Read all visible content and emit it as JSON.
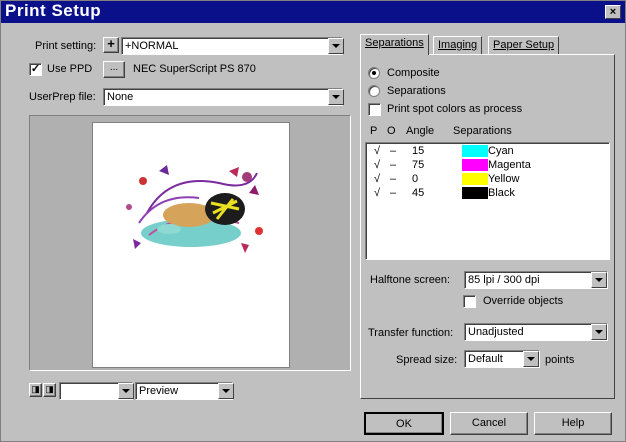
{
  "window": {
    "title": "Print Setup",
    "close_glyph": "×"
  },
  "left": {
    "print_setting_label": "Print setting:",
    "print_setting_value": "+NORMAL",
    "use_ppd_checked": true,
    "use_ppd_label": "Use PPD",
    "ppd_browse_label": "...",
    "ppd_name": "NEC SuperScript PS 870",
    "user_prep_label": "UserPrep file:",
    "user_prep_value": "None",
    "view_select_value": "",
    "preview_select_value": "Preview"
  },
  "tabs": [
    {
      "label": "Separations",
      "active": true
    },
    {
      "label": "Imaging",
      "active": false
    },
    {
      "label": "Paper Setup",
      "active": false
    }
  ],
  "separations": {
    "composite_label": "Composite",
    "separations_label": "Separations",
    "selected": "composite",
    "print_spot_label": "Print spot colors as process",
    "print_spot_checked": false,
    "headers": {
      "p": "P",
      "o": "O",
      "angle": "Angle",
      "sep": "Separations"
    },
    "rows": [
      {
        "p": "√",
        "o": "–",
        "angle": "15",
        "name": "Cyan",
        "color": "#00ffff"
      },
      {
        "p": "√",
        "o": "–",
        "angle": "75",
        "name": "Magenta",
        "color": "#ff00ff"
      },
      {
        "p": "√",
        "o": "–",
        "angle": "0",
        "name": "Yellow",
        "color": "#ffff00"
      },
      {
        "p": "√",
        "o": "–",
        "angle": "45",
        "name": "Black",
        "color": "#000000"
      }
    ],
    "halftone_label": "Halftone screen:",
    "halftone_value": "85 lpi / 300 dpi",
    "override_label": "Override objects",
    "override_checked": false,
    "transfer_label": "Transfer function:",
    "transfer_value": "Unadjusted",
    "spread_label": "Spread size:",
    "spread_value": "Default",
    "spread_unit": "points"
  },
  "buttons": {
    "ok": "OK",
    "cancel": "Cancel",
    "help": "Help"
  },
  "colors": {
    "titlebar": "#0a0f8a",
    "face": "#c0c0c0"
  }
}
